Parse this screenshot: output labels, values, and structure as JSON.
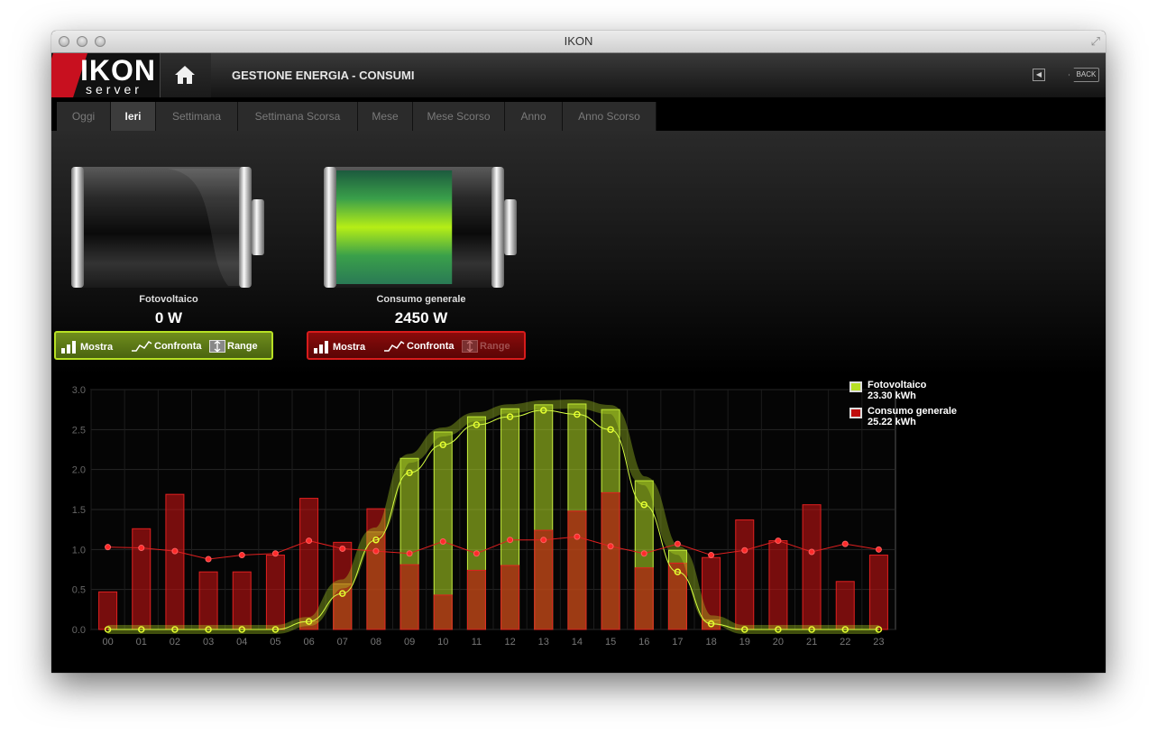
{
  "window": {
    "title": "IKON"
  },
  "header": {
    "logo_main": "IKON",
    "logo_sub": "server",
    "page_title": "GESTIONE ENERGIA - CONSUMI",
    "back_label": "BACK"
  },
  "tabs": [
    {
      "label": "Oggi"
    },
    {
      "label": "Ieri",
      "active": true
    },
    {
      "label": "Settimana"
    },
    {
      "label": "Settimana Scorsa"
    },
    {
      "label": "Mese"
    },
    {
      "label": "Mese Scorso"
    },
    {
      "label": "Anno"
    },
    {
      "label": "Anno Scorso"
    }
  ],
  "meters": [
    {
      "label": "Fotovoltaico",
      "value": "0 W",
      "fill_fraction": 0,
      "color": "#b7e024"
    },
    {
      "label": "Consumo generale",
      "value": "2450 W",
      "fill_fraction": 0.74,
      "color": "#d81b1b"
    }
  ],
  "controls": {
    "green": {
      "show": "Mostra",
      "compare": "Confronta",
      "range": "Range"
    },
    "red": {
      "show": "Mostra",
      "compare": "Confronta",
      "range": "Range"
    }
  },
  "legend": [
    {
      "name": "Fotovoltaico",
      "total": "23.30 kWh",
      "color": "#b7e024"
    },
    {
      "name": "Consumo generale",
      "total": "25.22 kWh",
      "color": "#d81b1b"
    }
  ],
  "chart_data": {
    "type": "bar",
    "categories": [
      "00",
      "01",
      "02",
      "03",
      "04",
      "05",
      "06",
      "07",
      "08",
      "09",
      "10",
      "11",
      "12",
      "13",
      "14",
      "15",
      "16",
      "17",
      "18",
      "19",
      "20",
      "21",
      "22",
      "23"
    ],
    "ylim": [
      0,
      3.0
    ],
    "yticks": [
      "0.0",
      "0.5",
      "1.0",
      "1.5",
      "2.0",
      "2.5",
      "3.0"
    ],
    "grid": true,
    "legend_position": "right",
    "series": [
      {
        "name": "Fotovoltaico",
        "color": "#b7e024",
        "bars": [
          0,
          0,
          0,
          0,
          0,
          0,
          0.1,
          0.57,
          1.22,
          2.14,
          2.47,
          2.66,
          2.76,
          2.81,
          2.82,
          2.75,
          1.86,
          0.99,
          0.12,
          0,
          0,
          0,
          0,
          0
        ],
        "line": [
          0,
          0,
          0,
          0,
          0,
          0,
          0.1,
          0.45,
          1.12,
          1.96,
          2.31,
          2.56,
          2.66,
          2.74,
          2.69,
          2.5,
          1.56,
          0.72,
          0.07,
          0,
          0,
          0,
          0,
          0
        ]
      },
      {
        "name": "Consumo generale",
        "color": "#d81b1b",
        "bars": [
          0.47,
          1.26,
          1.69,
          0.72,
          0.72,
          0.93,
          1.64,
          1.09,
          1.51,
          0.81,
          0.43,
          0.74,
          0.8,
          1.24,
          1.48,
          1.71,
          0.77,
          0.83,
          0.9,
          1.37,
          1.11,
          1.56,
          0.6,
          0.93
        ],
        "line": [
          1.03,
          1.02,
          0.98,
          0.88,
          0.93,
          0.95,
          1.11,
          1.01,
          0.98,
          0.95,
          1.1,
          0.95,
          1.12,
          1.12,
          1.16,
          1.04,
          0.95,
          1.07,
          0.93,
          0.99,
          1.11,
          0.97,
          1.07,
          1.0
        ]
      }
    ]
  }
}
